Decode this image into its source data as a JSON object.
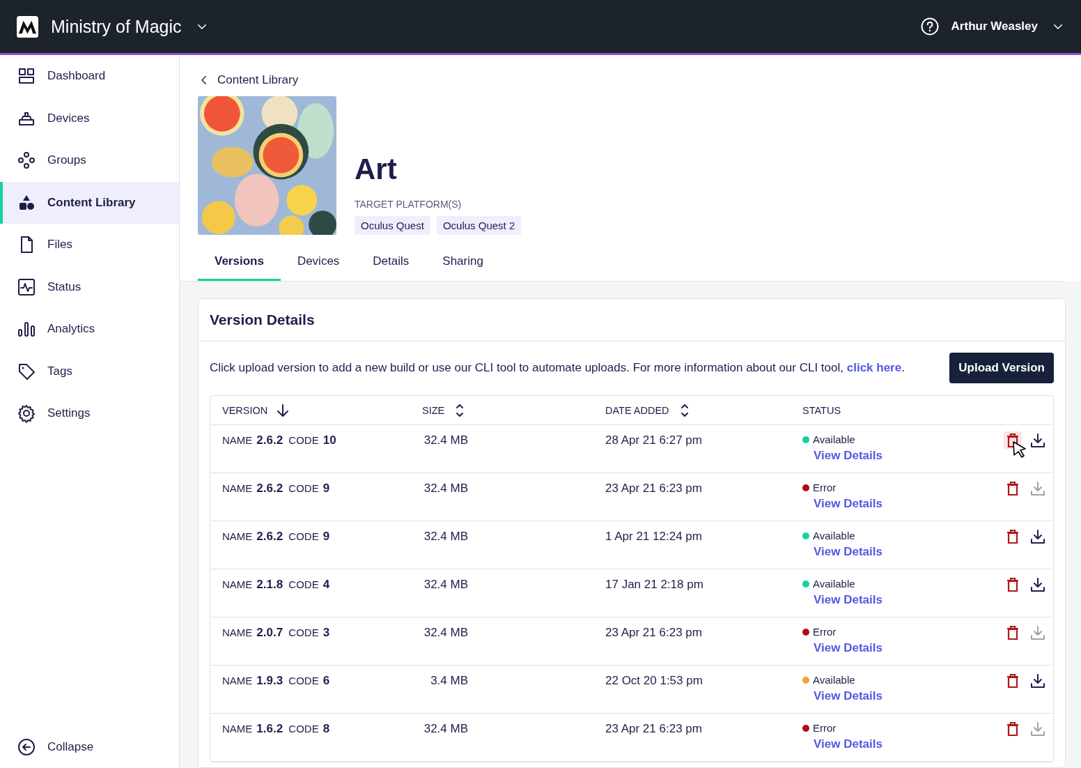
{
  "header": {
    "org": "Ministry of Magic",
    "user": "Arthur Weasley"
  },
  "sidebar": {
    "items": [
      {
        "label": "Dashboard",
        "selected": false
      },
      {
        "label": "Devices",
        "selected": false
      },
      {
        "label": "Groups",
        "selected": false
      },
      {
        "label": "Content Library",
        "selected": true
      },
      {
        "label": "Files",
        "selected": false
      },
      {
        "label": "Status",
        "selected": false
      },
      {
        "label": "Analytics",
        "selected": false
      },
      {
        "label": "Tags",
        "selected": false
      },
      {
        "label": "Settings",
        "selected": false
      }
    ],
    "collapse": "Collapse"
  },
  "breadcrumb": "Content Library",
  "app": {
    "title": "Art",
    "platforms_label": "TARGET PLATFORM(S)",
    "platforms": [
      "Oculus Quest",
      "Oculus Quest 2"
    ]
  },
  "tabs": [
    {
      "label": "Versions",
      "selected": true
    },
    {
      "label": "Devices",
      "selected": false
    },
    {
      "label": "Details",
      "selected": false
    },
    {
      "label": "Sharing",
      "selected": false
    }
  ],
  "card": {
    "title": "Version Details",
    "intro": "Click upload version to add a new build or use our CLI tool to automate uploads. For more information about our CLI tool, ",
    "link": "click here",
    "after_link": ".",
    "upload_button": "Upload Version"
  },
  "table": {
    "columns": [
      {
        "label": "VERSION",
        "sortable": true,
        "sorted": true
      },
      {
        "label": "SIZE",
        "sortable": true,
        "sorted": false
      },
      {
        "label": "DATE ADDED",
        "sortable": true,
        "sorted": false
      },
      {
        "label": "STATUS",
        "sortable": false
      }
    ],
    "rows": [
      {
        "name_label": "NAME",
        "name": "2.6.2",
        "code_label": "CODE",
        "code": "10",
        "size": "32.4 MB",
        "date": "28 Apr 21 6:27 pm",
        "status": "Available",
        "color": "#14d39a",
        "link": "View Details",
        "download_disabled": false,
        "delete_hovered": true
      },
      {
        "name_label": "NAME",
        "name": "2.6.2",
        "code_label": "CODE",
        "code": "9",
        "size": "32.4 MB",
        "date": "23 Apr 21 6:23 pm",
        "status": "Error",
        "color": "#b00a1a",
        "link": "View Details",
        "download_disabled": true,
        "delete_hovered": false
      },
      {
        "name_label": "NAME",
        "name": "2.6.2",
        "code_label": "CODE",
        "code": "9",
        "size": "32.4 MB",
        "date": "1 Apr 21 12:24 pm",
        "status": "Available",
        "color": "#14d39a",
        "link": "View Details",
        "download_disabled": false,
        "delete_hovered": false
      },
      {
        "name_label": "NAME",
        "name": "2.1.8",
        "code_label": "CODE",
        "code": "4",
        "size": "32.4 MB",
        "date": "17 Jan 21 2:18 pm",
        "status": "Available",
        "color": "#14d39a",
        "link": "View Details",
        "download_disabled": false,
        "delete_hovered": false
      },
      {
        "name_label": "NAME",
        "name": "2.0.7",
        "code_label": "CODE",
        "code": "3",
        "size": "32.4 MB",
        "date": "23 Apr 21 6:23 pm",
        "status": "Error",
        "color": "#b00a1a",
        "link": "View Details",
        "download_disabled": true,
        "delete_hovered": false
      },
      {
        "name_label": "NAME",
        "name": "1.9.3",
        "code_label": "CODE",
        "code": "6",
        "size": "3.4 MB",
        "date": "22 Oct 20 1:53 pm",
        "status": "Available",
        "color": "#f7a030",
        "link": "View Details",
        "download_disabled": false,
        "delete_hovered": false
      },
      {
        "name_label": "NAME",
        "name": "1.6.2",
        "code_label": "CODE",
        "code": "8",
        "size": "32.4 MB",
        "date": "23 Apr 21 6:23 pm",
        "status": "Error",
        "color": "#b00a1a",
        "link": "View Details",
        "download_disabled": true,
        "delete_hovered": false
      }
    ]
  }
}
